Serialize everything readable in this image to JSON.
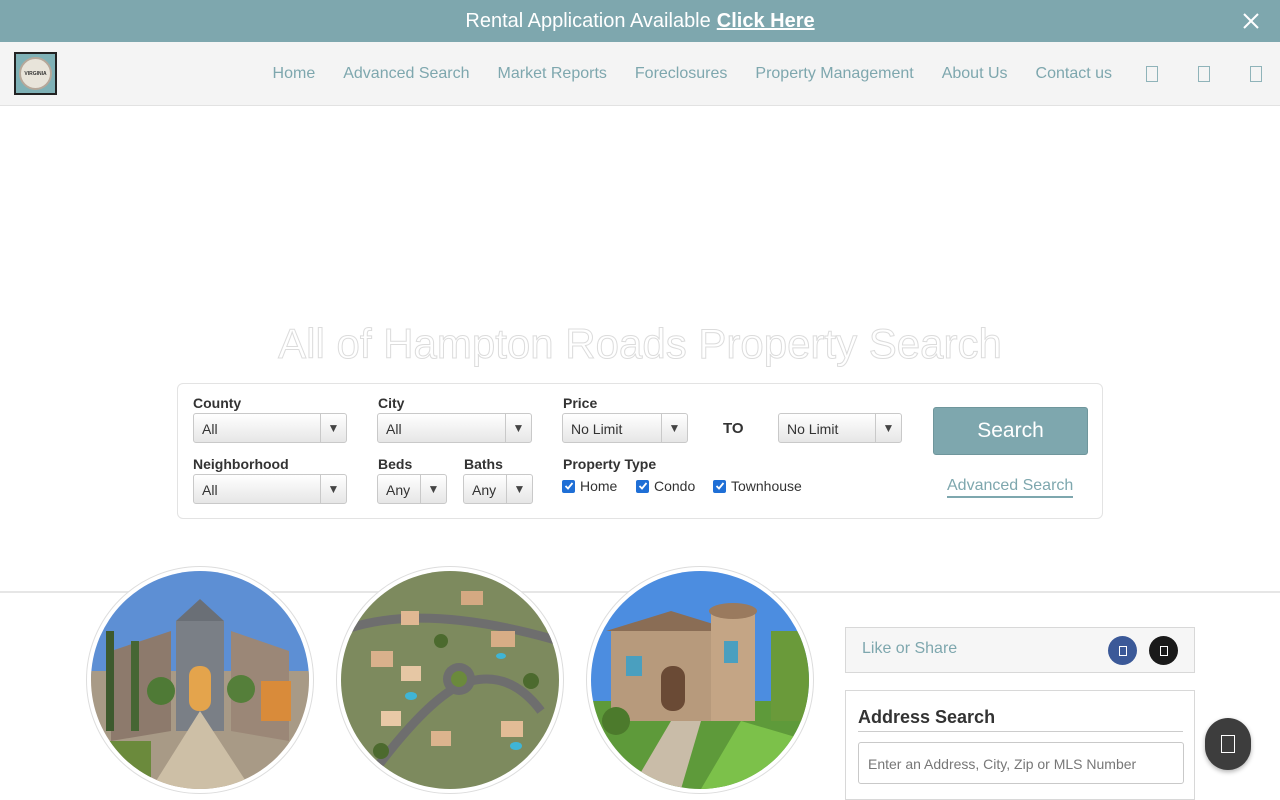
{
  "banner": {
    "text": "Rental Application Available",
    "link": "Click Here",
    "close_icon": "close-icon"
  },
  "nav": {
    "logo_text": "VIRGINIA",
    "items": [
      "Home",
      "Advanced Search",
      "Market Reports",
      "Foreclosures",
      "Property Management",
      "About Us",
      "Contact us"
    ],
    "icons": [
      "user-icon",
      "heart-icon",
      "menu-icon"
    ]
  },
  "hero": {
    "title": "All of Hampton Roads Property Search"
  },
  "search": {
    "county": {
      "label": "County",
      "value": "All"
    },
    "city": {
      "label": "City",
      "value": "All"
    },
    "price": {
      "label": "Price",
      "min": "No Limit",
      "to": "TO",
      "max": "No Limit"
    },
    "neighborhood": {
      "label": "Neighborhood",
      "value": "All"
    },
    "beds": {
      "label": "Beds",
      "value": "Any"
    },
    "baths": {
      "label": "Baths",
      "value": "Any"
    },
    "property_type": {
      "label": "Property Type",
      "options": [
        "Home",
        "Condo",
        "Townhouse"
      ],
      "checked": [
        true,
        true,
        true
      ]
    },
    "search_button": "Search",
    "advanced_link": "Advanced Search"
  },
  "share": {
    "label": "Like or Share",
    "icons": [
      "facebook-icon",
      "x-icon"
    ]
  },
  "address_search": {
    "title": "Address Search",
    "placeholder": "Enter an Address, City, Zip or MLS Number"
  },
  "colors": {
    "accent": "#7ea7ae",
    "checkbox": "#1f6fd6",
    "facebook": "#3b5998"
  }
}
